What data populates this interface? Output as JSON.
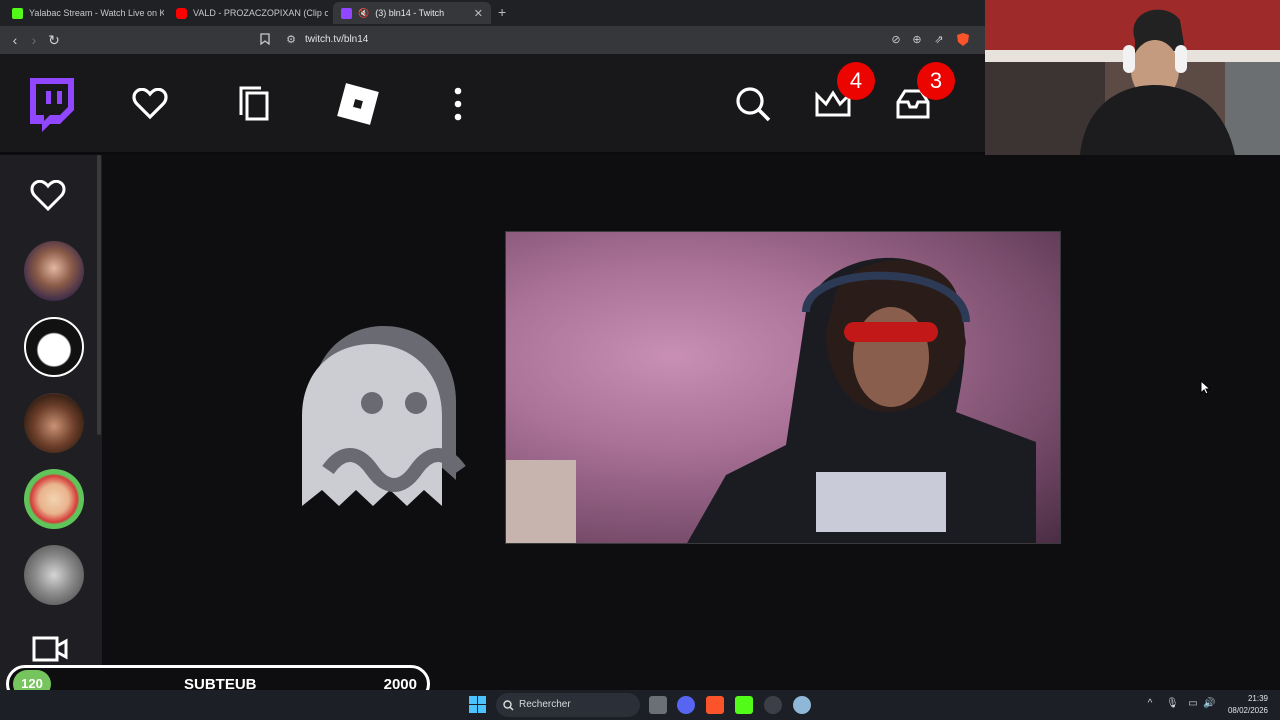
{
  "browser": {
    "tabs": [
      {
        "title": "Yalabac Stream - Watch Live on Kick",
        "favicon_color": "#53fc18"
      },
      {
        "title": "VALD - PROZACZOPIXAN (Clip offici...",
        "favicon_color": "#ff0000"
      },
      {
        "title": "(3) bln14 - Twitch",
        "favicon_color": "#9146ff"
      }
    ],
    "new_tab": "+",
    "url": "twitch.tv/bln14"
  },
  "twitch": {
    "brand_color": "#9146ff",
    "header_icons": [
      "twitch-logo-icon",
      "heart-icon",
      "copy-icon",
      "roblox-icon",
      "more-vertical-icon",
      "search-icon",
      "crown-icon",
      "inbox-icon"
    ],
    "badges": {
      "prime": "4",
      "inbox": "3"
    },
    "sidebar": {
      "icons": [
        "heart-icon",
        "video-camera-icon"
      ],
      "avatars": [
        "channel-avatar-1",
        "channel-avatar-2",
        "channel-avatar-3",
        "channel-avatar-4",
        "channel-avatar-5"
      ]
    }
  },
  "overlay": {
    "sub_count": "120",
    "sub_label": "SUBTEUB",
    "sub_target": "2000",
    "accent": "#76c45d"
  },
  "taskbar": {
    "search_placeholder": "Rechercher",
    "time": "21:39",
    "date": "08/02/2026"
  }
}
